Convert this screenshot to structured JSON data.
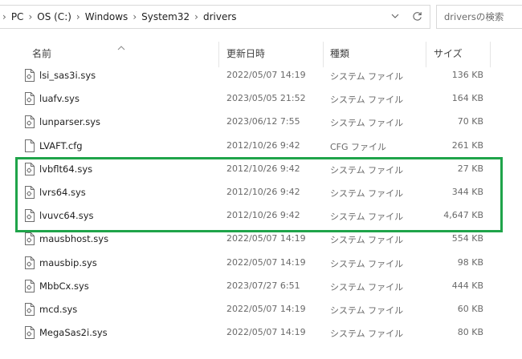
{
  "address_bar": {
    "crumbs": [
      "PC",
      "OS (C:)",
      "Windows",
      "System32",
      "drivers"
    ],
    "separator": "›"
  },
  "search": {
    "placeholder": "driversの検索"
  },
  "columns": {
    "name": "名前",
    "date": "更新日時",
    "type": "種類",
    "size": "サイズ"
  },
  "files": [
    {
      "name": "lsi_sas3i.sys",
      "date": "2022/05/07 14:19",
      "type": "システム ファイル",
      "size": "136 KB",
      "icon": "system-file-icon"
    },
    {
      "name": "luafv.sys",
      "date": "2023/05/05 21:52",
      "type": "システム ファイル",
      "size": "164 KB",
      "icon": "system-file-icon"
    },
    {
      "name": "lunparser.sys",
      "date": "2023/06/12 7:55",
      "type": "システム ファイル",
      "size": "70 KB",
      "icon": "system-file-icon"
    },
    {
      "name": "LVAFT.cfg",
      "date": "2012/10/26 9:42",
      "type": "CFG ファイル",
      "size": "261 KB",
      "icon": "blank-file-icon"
    },
    {
      "name": "lvbflt64.sys",
      "date": "2012/10/26 9:42",
      "type": "システム ファイル",
      "size": "27 KB",
      "icon": "system-file-icon"
    },
    {
      "name": "lvrs64.sys",
      "date": "2012/10/26 9:42",
      "type": "システム ファイル",
      "size": "344 KB",
      "icon": "system-file-icon"
    },
    {
      "name": "lvuvc64.sys",
      "date": "2012/10/26 9:42",
      "type": "システム ファイル",
      "size": "4,647 KB",
      "icon": "system-file-icon"
    },
    {
      "name": "mausbhost.sys",
      "date": "2022/05/07 14:19",
      "type": "システム ファイル",
      "size": "554 KB",
      "icon": "system-file-icon"
    },
    {
      "name": "mausbip.sys",
      "date": "2022/05/07 14:19",
      "type": "システム ファイル",
      "size": "98 KB",
      "icon": "system-file-icon"
    },
    {
      "name": "MbbCx.sys",
      "date": "2023/07/27 6:51",
      "type": "システム ファイル",
      "size": "444 KB",
      "icon": "system-file-icon"
    },
    {
      "name": "mcd.sys",
      "date": "2022/05/07 14:19",
      "type": "システム ファイル",
      "size": "60 KB",
      "icon": "system-file-icon"
    },
    {
      "name": "MegaSas2i.sys",
      "date": "2022/05/07 14:19",
      "type": "システム ファイル",
      "size": "80 KB",
      "icon": "system-file-icon"
    }
  ],
  "highlight_color": "#1fa44a"
}
